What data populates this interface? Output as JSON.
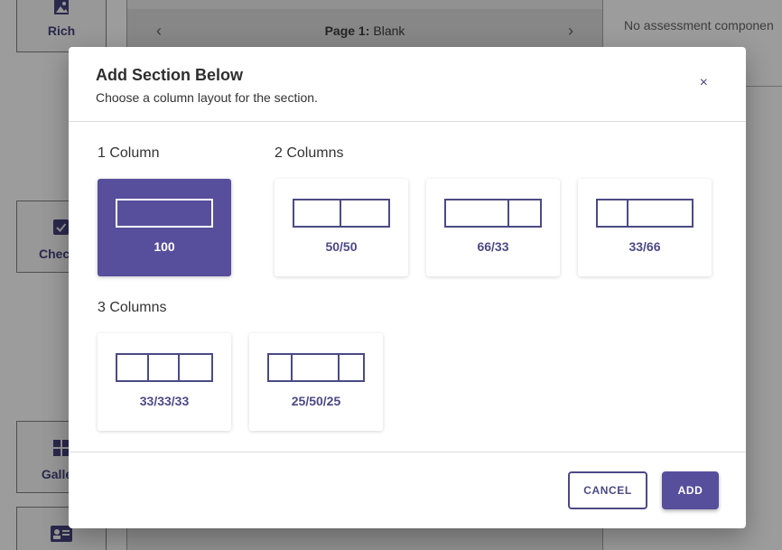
{
  "background": {
    "tiles": [
      {
        "label": "Rich",
        "icon": "image-icon"
      },
      {
        "label": "Check",
        "icon": "checkbox-icon"
      },
      {
        "label": "Galle",
        "icon": "grid-icon"
      },
      {
        "label": "",
        "icon": "id-card-icon"
      }
    ],
    "page_bar": {
      "prefix": "Page 1:",
      "name": "Blank",
      "prev_icon": "chevron-left-icon",
      "next_icon": "chevron-right-icon"
    },
    "right_panel_text": "No assessment componen"
  },
  "modal": {
    "title": "Add Section Below",
    "subtitle": "Choose a column layout for the section.",
    "close_icon": "×",
    "groups": [
      {
        "label": "1 Column",
        "options": [
          {
            "label": "100",
            "selected": true
          }
        ]
      },
      {
        "label": "2 Columns",
        "options": [
          {
            "label": "50/50"
          },
          {
            "label": "66/33"
          },
          {
            "label": "33/66"
          }
        ]
      },
      {
        "label": "3 Columns",
        "options": [
          {
            "label": "33/33/33"
          },
          {
            "label": "25/50/25"
          }
        ]
      }
    ],
    "cancel_label": "CANCEL",
    "add_label": "ADD"
  },
  "colors": {
    "accent": "#574e9c",
    "accent_dark": "#4b4a85"
  }
}
